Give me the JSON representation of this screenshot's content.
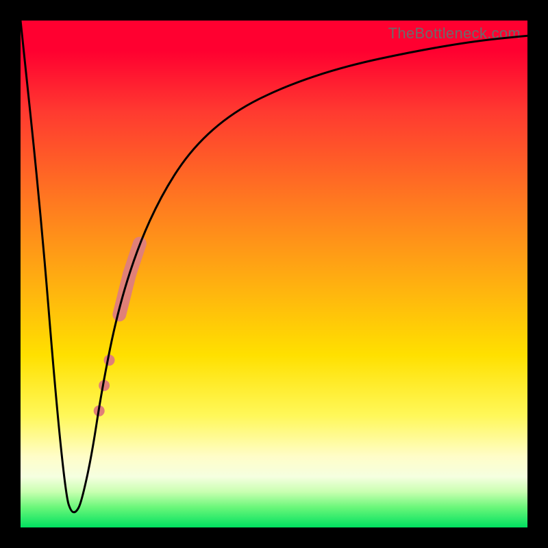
{
  "watermark": "TheBottleneck.com",
  "chart_data": {
    "type": "line",
    "title": "",
    "xlabel": "",
    "ylabel": "",
    "xlim": [
      0,
      100
    ],
    "ylim": [
      0,
      100
    ],
    "grid": false,
    "series": [
      {
        "name": "bottleneck-curve",
        "color": "#000000",
        "x": [
          0,
          4,
          7,
          9,
          10,
          11,
          12,
          14,
          16,
          19,
          23,
          28,
          34,
          42,
          52,
          64,
          78,
          90,
          100
        ],
        "values": [
          100,
          62,
          25,
          6,
          3,
          3,
          5,
          14,
          27,
          42,
          55,
          66,
          75,
          82,
          87,
          91,
          94,
          96,
          97
        ]
      }
    ],
    "markers": {
      "name": "highlight-band",
      "color": "#e08078",
      "points": [
        {
          "x": 15.5,
          "y": 23
        },
        {
          "x": 16.5,
          "y": 28
        },
        {
          "x": 17.5,
          "y": 33
        },
        {
          "x": 19.5,
          "y": 42
        },
        {
          "x": 20.5,
          "y": 46
        },
        {
          "x": 21.5,
          "y": 50
        },
        {
          "x": 22.5,
          "y": 53
        },
        {
          "x": 23.5,
          "y": 56
        }
      ],
      "dot_radius_small": 8,
      "dot_radius_large": 10
    }
  }
}
